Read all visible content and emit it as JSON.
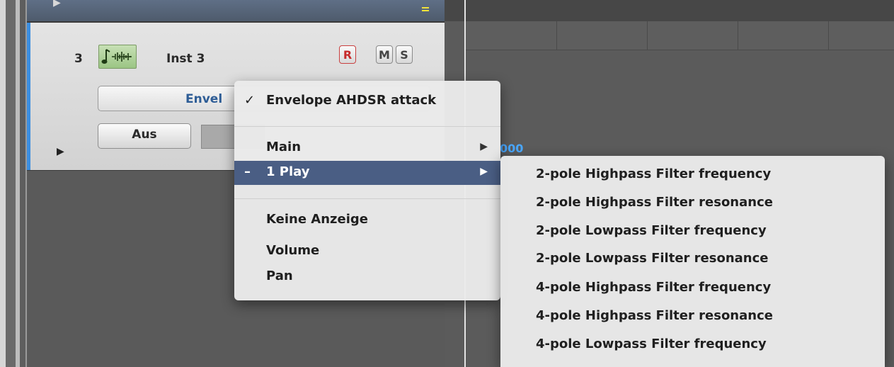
{
  "track": {
    "number": "3",
    "name": "Inst 3",
    "record_label": "R",
    "mute_label": "M",
    "solo_label": "S",
    "automation_parameter": "Envelope AHDSR attack",
    "automation_parameter_truncated": "Envel",
    "mode_label": "Aus"
  },
  "timeline": {
    "value_text": "000"
  },
  "menu": {
    "checked_item": "Envelope AHDSR attack",
    "checkmark": "✓",
    "items": [
      {
        "label": "Main",
        "submenu": true
      },
      {
        "label": "1 Play",
        "prefix": "–",
        "submenu": true,
        "highlighted": true
      },
      {
        "label": "Keine Anzeige"
      },
      {
        "label": "Volume"
      },
      {
        "label": "Pan"
      }
    ]
  },
  "submenu": {
    "items": [
      "2-pole Highpass Filter frequency",
      "2-pole Highpass Filter resonance",
      "2-pole Lowpass Filter frequency",
      "2-pole Lowpass Filter resonance",
      "4-pole Highpass Filter frequency",
      "4-pole Highpass Filter resonance",
      "4-pole Lowpass Filter frequency"
    ]
  },
  "icons": {
    "submenu_arrow": "▶",
    "disclosure": "▶",
    "instrument": "software-instrument-icon"
  },
  "colors": {
    "highlight": "#4a5e84",
    "record": "#c62a2a",
    "track_select": "#3b8ee0",
    "param_text": "#2e5d96"
  }
}
